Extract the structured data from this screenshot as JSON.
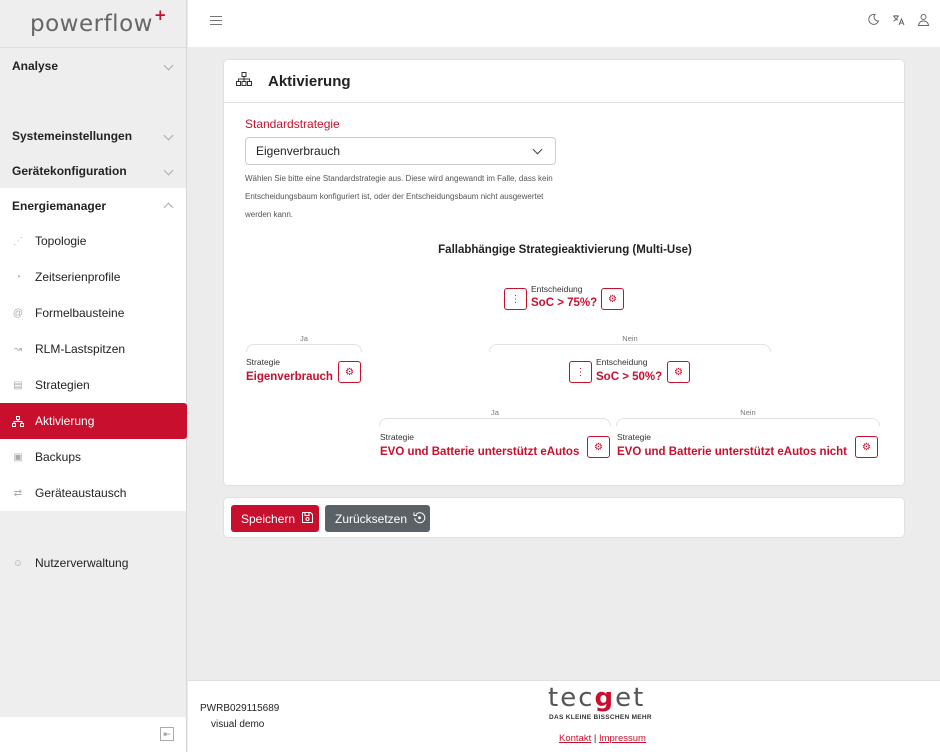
{
  "brand": {
    "name": "powerflow",
    "plus": "+"
  },
  "sidebar": {
    "sections": [
      {
        "label": "Analyse"
      },
      {
        "label": "Systemeinstellungen"
      },
      {
        "label": "Gerätekonfiguration"
      },
      {
        "label": "Energiemanager"
      }
    ],
    "items": [
      {
        "label": "Topologie",
        "icon": "topology-icon"
      },
      {
        "label": "Zeitserienprofile",
        "icon": "timeseries-icon"
      },
      {
        "label": "Formelbausteine",
        "icon": "formula-icon"
      },
      {
        "label": "RLM-Lastspitzen",
        "icon": "peak-icon"
      },
      {
        "label": "Strategien",
        "icon": "strategies-icon"
      },
      {
        "label": "Aktivierung",
        "icon": "hierarchy-icon",
        "active": true
      },
      {
        "label": "Backups",
        "icon": "backup-icon"
      },
      {
        "label": "Geräteaustausch",
        "icon": "exchange-icon"
      }
    ],
    "user_management": "Nutzerverwaltung"
  },
  "page": {
    "title": "Aktivierung",
    "strategy_label": "Standardstrategie",
    "strategy_value": "Eigenverbrauch",
    "help_text": "Wählen Sie bitte eine Standardstrategie aus. Diese wird angewandt im Falle, dass kein Entscheidungsbaum konfiguriert ist, oder der Entscheidungsbaum nicht ausgewertet werden kann.",
    "tree_title": "Fallabhängige Strategieaktivierung (Multi-Use)"
  },
  "tree": {
    "root": {
      "label": "Entscheidung",
      "value": "SoC > 75%?"
    },
    "yes_label": "Ja",
    "no_label": "Nein",
    "left_strategy": {
      "label": "Strategie",
      "value": "Eigenverbrauch"
    },
    "decision2": {
      "label": "Entscheidung",
      "value": "SoC > 50%?"
    },
    "yes2_label": "Ja",
    "no2_label": "Nein",
    "strategy_a": {
      "label": "Strategie",
      "value": "EVO und Batterie unterstützt eAutos"
    },
    "strategy_b": {
      "label": "Strategie",
      "value": "EVO und Batterie unterstützt eAutos nicht"
    }
  },
  "actions": {
    "save": "Speichern",
    "reset": "Zurücksetzen"
  },
  "footer": {
    "serial": "PWRB029115689",
    "mode": "visual demo",
    "company_pre": "tec",
    "company_g": "g",
    "company_post": "et",
    "tagline": "DAS KLEINE BISSCHEN MEHR",
    "contact": "Kontakt",
    "separator": "|",
    "imprint": "Impressum"
  },
  "colors": {
    "accent": "#c8102e",
    "secondary_button": "#5a6268"
  }
}
